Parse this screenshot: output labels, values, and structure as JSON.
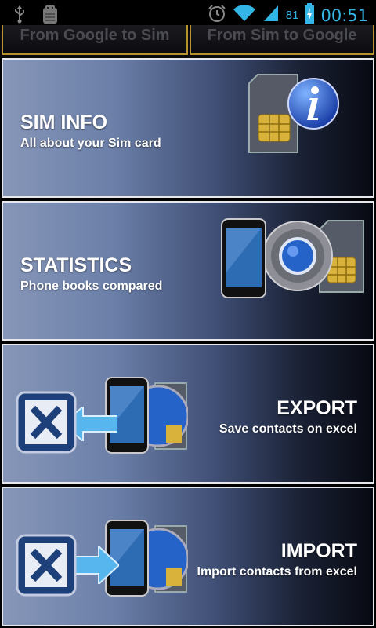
{
  "status_bar": {
    "left_icons": [
      "usb-icon",
      "android-debug-icon"
    ],
    "right_icons": [
      "alarm-icon",
      "wifi-icon",
      "signal-icon",
      "battery-charging-icon"
    ],
    "battery_percent": "81",
    "time": "00:51"
  },
  "tabs": [
    {
      "label": "From Google to Sim"
    },
    {
      "label": "From Sim to Google"
    }
  ],
  "cards": [
    {
      "title": "SIM INFO",
      "subtitle": "All about your Sim card",
      "icons": [
        "sim-card-icon",
        "info-icon"
      ]
    },
    {
      "title": "STATISTICS",
      "subtitle": "Phone books compared",
      "icons": [
        "phone-icon",
        "chrome-icon",
        "sim-card-icon"
      ]
    },
    {
      "title": "EXPORT",
      "subtitle": "Save contacts on excel",
      "icons": [
        "excel-icon",
        "arrow-left-icon",
        "phone-icon",
        "chrome-icon"
      ]
    },
    {
      "title": "IMPORT",
      "subtitle": "Import contacts from excel",
      "icons": [
        "excel-icon",
        "arrow-right-icon",
        "phone-icon",
        "chrome-icon"
      ]
    }
  ],
  "colors": {
    "status_accent": "#33b5e5",
    "tab_border": "#b8922e",
    "card_gradient_light": "#8696b8",
    "card_gradient_dark": "#080a12"
  }
}
